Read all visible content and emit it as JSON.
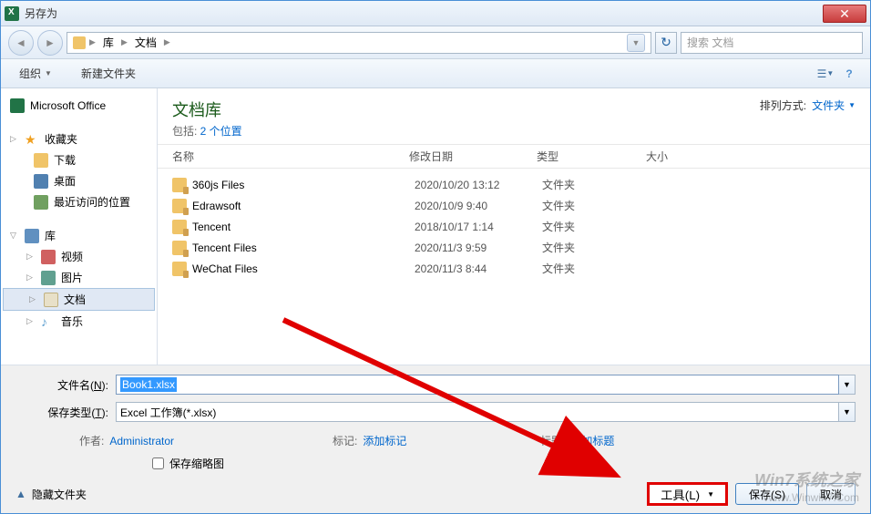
{
  "window": {
    "title": "另存为"
  },
  "nav": {
    "breadcrumb": [
      "库",
      "文档"
    ],
    "search_placeholder": "搜索 文档"
  },
  "toolbar": {
    "organize": "组织",
    "new_folder": "新建文件夹"
  },
  "sidebar": {
    "ms_office": "Microsoft Office",
    "favorites": "收藏夹",
    "downloads": "下载",
    "desktop": "桌面",
    "recent": "最近访问的位置",
    "libraries": "库",
    "video": "视频",
    "pictures": "图片",
    "documents": "文档",
    "music": "音乐"
  },
  "content": {
    "lib_title": "文档库",
    "lib_sub_prefix": "包括: ",
    "lib_sub_link": "2 个位置",
    "sort_label": "排列方式:",
    "sort_value": "文件夹",
    "columns": {
      "name": "名称",
      "date": "修改日期",
      "type": "类型",
      "size": "大小"
    },
    "files": [
      {
        "name": "360js Files",
        "date": "2020/10/20 13:12",
        "type": "文件夹"
      },
      {
        "name": "Edrawsoft",
        "date": "2020/10/9 9:40",
        "type": "文件夹"
      },
      {
        "name": "Tencent",
        "date": "2018/10/17 1:14",
        "type": "文件夹"
      },
      {
        "name": "Tencent Files",
        "date": "2020/11/3 9:59",
        "type": "文件夹"
      },
      {
        "name": "WeChat Files",
        "date": "2020/11/3 8:44",
        "type": "文件夹"
      }
    ]
  },
  "form": {
    "filename_label_pre": "文件名(",
    "filename_label_key": "N",
    "filename_label_post": "):",
    "filename_value": "Book1.xlsx",
    "savetype_label_pre": "保存类型(",
    "savetype_label_key": "T",
    "savetype_label_post": "):",
    "savetype_value": "Excel 工作簿(*.xlsx)",
    "author_label": "作者:",
    "author_value": "Administrator",
    "tags_label": "标记:",
    "tags_value": "添加标记",
    "title_label": "标题:",
    "title_value": "添加标题",
    "thumb_label": "保存缩略图",
    "hide_folders": "隐藏文件夹",
    "tools_label": "工具(L)",
    "save_label": "保存(S)",
    "cancel_label": "取消"
  },
  "watermark": {
    "line1": "Win7系统之家",
    "line2": "Www.Winwin7.Com"
  }
}
